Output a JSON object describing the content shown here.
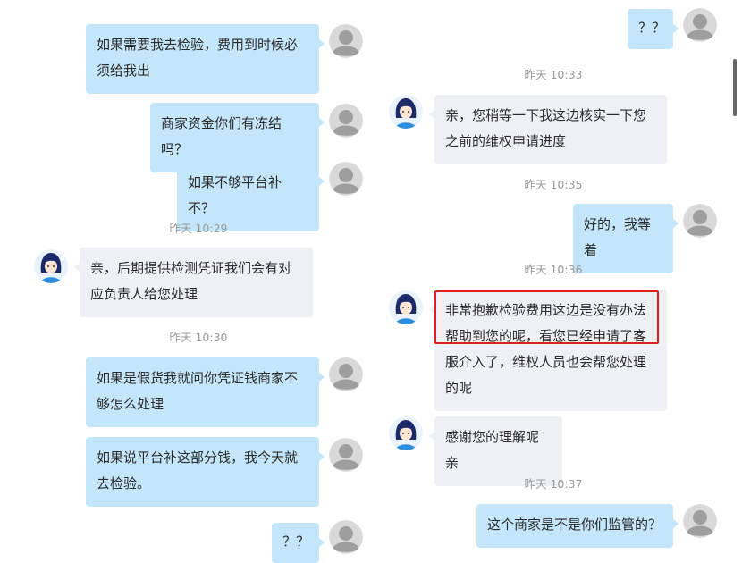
{
  "left_column": {
    "messages": [
      {
        "from": "user",
        "lines": [
          "如果需要我去检验，费用到时候必",
          "须给我出"
        ]
      },
      {
        "from": "user",
        "lines": [
          "商家资金你们有冻结吗？"
        ]
      },
      {
        "from": "user",
        "lines": [
          "如果不够平台补不？"
        ]
      },
      {
        "timestamp": "昨天 10:29"
      },
      {
        "from": "agent",
        "lines": [
          "亲，后期提供检测凭证我们会有对",
          "应负责人给您处理"
        ]
      },
      {
        "timestamp": "昨天 10:30"
      },
      {
        "from": "user",
        "lines": [
          "如果是假货我就问你凭证钱商家不",
          "够怎么处理"
        ]
      },
      {
        "from": "user",
        "lines": [
          "如果说平台补这部分钱，我今天就",
          "去检验。"
        ]
      },
      {
        "from": "user",
        "lines": [
          "？？"
        ]
      }
    ]
  },
  "right_column": {
    "messages": [
      {
        "from": "user",
        "lines": [
          "？？"
        ]
      },
      {
        "timestamp": "昨天 10:33"
      },
      {
        "from": "agent",
        "lines": [
          "亲，您稍等一下我这边核实一下您",
          "之前的维权申请进度"
        ]
      },
      {
        "timestamp": "昨天 10:35"
      },
      {
        "from": "user",
        "lines": [
          "好的，我等着"
        ]
      },
      {
        "timestamp": "昨天 10:36"
      },
      {
        "from": "agent",
        "lines": [
          "非常抱歉检验费用这边是没有办法",
          "帮助到您的呢，看您已经申请了客",
          "服介入了，维权人员也会帮您处理",
          "的呢"
        ],
        "highlighted_lines": 2
      },
      {
        "from": "agent",
        "lines": [
          "感谢您的理解呢亲"
        ]
      },
      {
        "timestamp": "昨天 10:37"
      },
      {
        "from": "user",
        "lines": [
          "这个商家是不是你们监管的？"
        ]
      }
    ]
  },
  "colors": {
    "sent_bubble": "#c4e6fb",
    "received_bubble": "#eef0f3",
    "timestamp_text": "#9a9a9a",
    "highlight_border": "#e02020",
    "user_avatar": "#b0b0b0",
    "agent_avatar_hair": "#1a2a6c"
  },
  "icons": {
    "user_avatar": "default-user-avatar-icon",
    "agent_avatar": "customer-service-agent-icon"
  }
}
